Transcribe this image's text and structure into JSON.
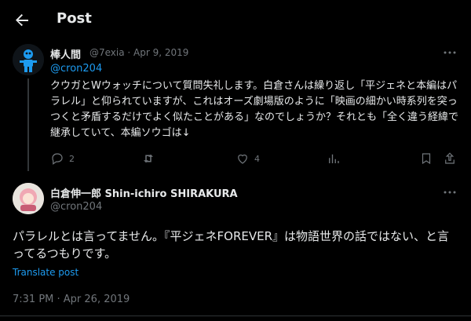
{
  "header": {
    "title": "Post"
  },
  "reply_post": {
    "author_name": "棒人間",
    "meta": "@7exia · Apr 9, 2019",
    "replying_to": "@cron204",
    "text": "クウガとWウォッチについて質問失礼します。白倉さんは繰り返し「平ジェネと本編はパラレル」と仰られていますが、これはオーズ劇場版のように「映画の細かい時系列を突っつくと矛盾するだけでよく似たことがある」なのでしょうか？それとも「全く違う経緯で継承していて、本編ソウゴは↓",
    "actions": {
      "replies": "2",
      "reposts": "",
      "likes": "4"
    }
  },
  "main_post": {
    "author_name": "白倉伸一郎 Shin-ichiro SHIRAKURA",
    "handle": "@cron204",
    "text": "パラレルとは言ってません。『平ジェネFOREVER』は物語世界の話ではない、と言ってるつもりです。",
    "translate_label": "Translate post",
    "timestamp": "7:31 PM · Apr 26, 2019"
  },
  "icons": [
    "back-arrow-icon",
    "more-icon",
    "reply-icon",
    "repost-icon",
    "like-icon",
    "views-icon",
    "bookmark-icon",
    "share-icon"
  ],
  "colors": {
    "background": "#000000",
    "text": "#e7e9ea",
    "muted": "#71767b",
    "link": "#1d9bf0"
  }
}
